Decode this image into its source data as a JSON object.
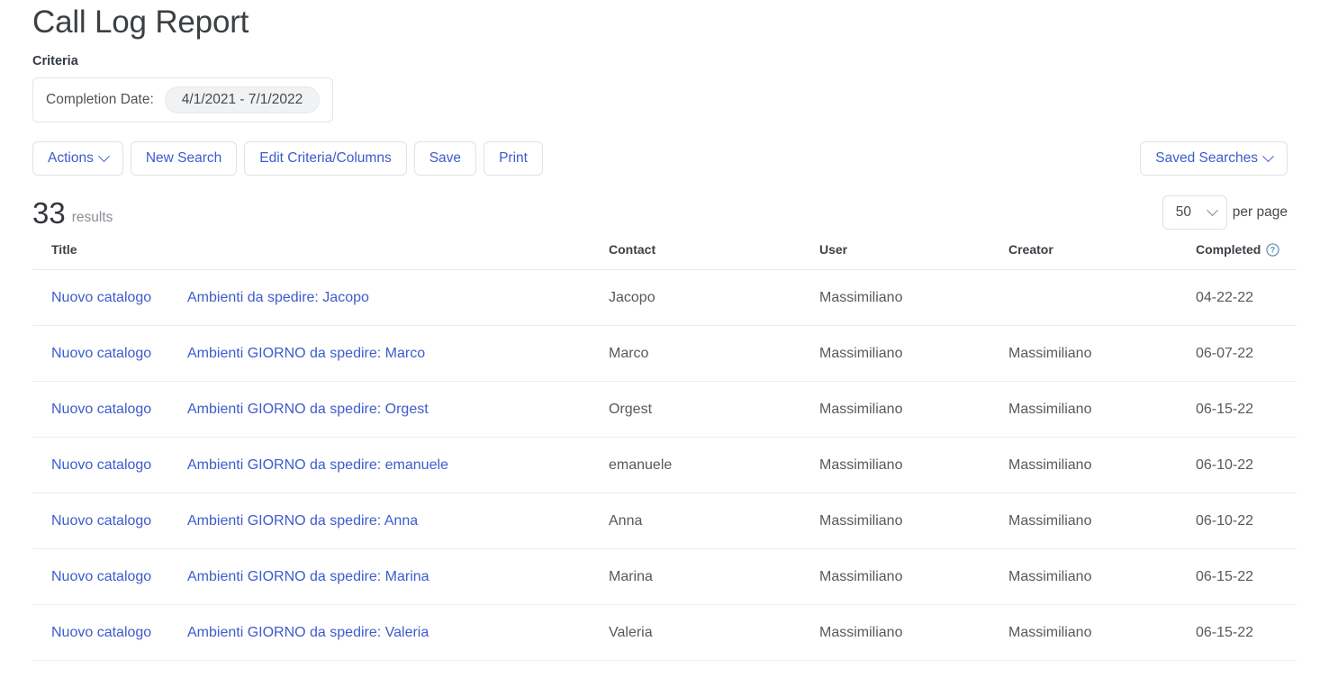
{
  "page": {
    "title": "Call Log Report"
  },
  "criteria": {
    "heading": "Criteria",
    "field_label": "Completion Date:",
    "field_value": "4/1/2021 - 7/1/2022"
  },
  "toolbar": {
    "actions_label": "Actions",
    "new_search_label": "New Search",
    "edit_criteria_label": "Edit Criteria/Columns",
    "save_label": "Save",
    "print_label": "Print",
    "saved_searches_label": "Saved Searches",
    "caret_icon": "chevron-down-icon"
  },
  "results": {
    "count": "33",
    "word": "results",
    "per_page_value": "50",
    "per_page_label": "per page",
    "per_page_options": [
      "50"
    ]
  },
  "table": {
    "columns": [
      {
        "key": "title",
        "label": "Title"
      },
      {
        "key": "subject",
        "label": ""
      },
      {
        "key": "contact",
        "label": "Contact"
      },
      {
        "key": "user",
        "label": "User"
      },
      {
        "key": "creator",
        "label": "Creator"
      },
      {
        "key": "completed",
        "label": "Completed"
      }
    ],
    "completed_help_icon": "help-circle-icon",
    "rows": [
      {
        "title": "Nuovo catalogo",
        "subject": "Ambienti da spedire: Jacopo",
        "contact": "Jacopo",
        "user": "Massimiliano",
        "creator": "",
        "completed": "04-22-22"
      },
      {
        "title": "Nuovo catalogo",
        "subject": "Ambienti GIORNO da spedire: Marco",
        "contact": "Marco",
        "user": "Massimiliano",
        "creator": "Massimiliano",
        "completed": "06-07-22"
      },
      {
        "title": "Nuovo catalogo",
        "subject": "Ambienti GIORNO da spedire: Orgest",
        "contact": "Orgest",
        "user": "Massimiliano",
        "creator": "Massimiliano",
        "completed": "06-15-22"
      },
      {
        "title": "Nuovo catalogo",
        "subject": "Ambienti GIORNO da spedire: emanuele",
        "contact": "emanuele",
        "user": "Massimiliano",
        "creator": "Massimiliano",
        "completed": "06-10-22"
      },
      {
        "title": "Nuovo catalogo",
        "subject": "Ambienti GIORNO da spedire: Anna",
        "contact": "Anna",
        "user": "Massimiliano",
        "creator": "Massimiliano",
        "completed": "06-10-22"
      },
      {
        "title": "Nuovo catalogo",
        "subject": "Ambienti GIORNO da spedire: Marina",
        "contact": "Marina",
        "user": "Massimiliano",
        "creator": "Massimiliano",
        "completed": "06-15-22"
      },
      {
        "title": "Nuovo catalogo",
        "subject": "Ambienti GIORNO da spedire: Valeria",
        "contact": "Valeria",
        "user": "Massimiliano",
        "creator": "Massimiliano",
        "completed": "06-15-22"
      }
    ]
  },
  "colors": {
    "link": "#3d5ccc",
    "text": "#56595d",
    "heading": "#3c4043",
    "border": "#e8eaec",
    "pill_bg": "#f1f2f3",
    "help_icon": "#5b8fb5"
  }
}
